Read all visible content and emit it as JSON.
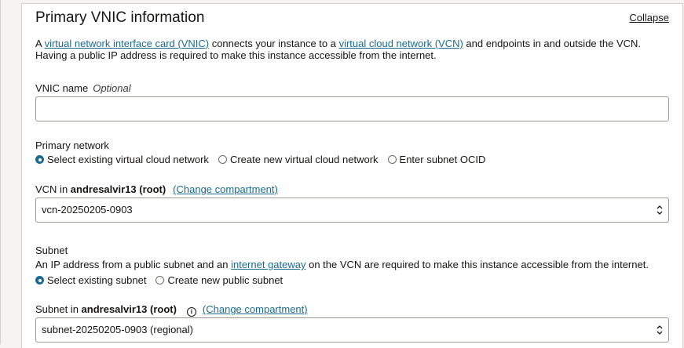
{
  "section": {
    "title": "Primary VNIC information",
    "collapse_label": "Collapse"
  },
  "description": {
    "part1": "A ",
    "link_vnic": "virtual network interface card (VNIC)",
    "part2": " connects your instance to a ",
    "link_vcn": "virtual cloud network (VCN)",
    "part3": " and endpoints in and outside the VCN. Having a public IP address is required to make this instance accessible from the internet."
  },
  "vnic_name": {
    "label": "VNIC name",
    "optional_label": "Optional",
    "value": ""
  },
  "primary_network": {
    "label": "Primary network",
    "options": [
      {
        "label": "Select existing virtual cloud network",
        "checked": true
      },
      {
        "label": "Create new virtual cloud network",
        "checked": false
      },
      {
        "label": "Enter subnet OCID",
        "checked": false
      }
    ]
  },
  "vcn": {
    "label_prefix": "VCN in ",
    "compartment": "andresalvir13 (root)",
    "change_link": "(Change compartment)",
    "selected": "vcn-20250205-0903"
  },
  "subnet": {
    "label": "Subnet",
    "help_part1": "An IP address from a public subnet and an ",
    "help_link": "internet gateway",
    "help_part2": " on the VCN are required to make this instance accessible from the internet.",
    "options": [
      {
        "label": "Select existing subnet",
        "checked": true
      },
      {
        "label": "Create new public subnet",
        "checked": false
      }
    ],
    "compartment_label_prefix": "Subnet in ",
    "compartment": "andresalvir13 (root)",
    "change_link": "(Change compartment)",
    "selected": "subnet-20250205-0903 (regional)"
  },
  "colors": {
    "link": "#1a6b8f",
    "border": "#9e9892",
    "background": "#f5f4f2"
  }
}
